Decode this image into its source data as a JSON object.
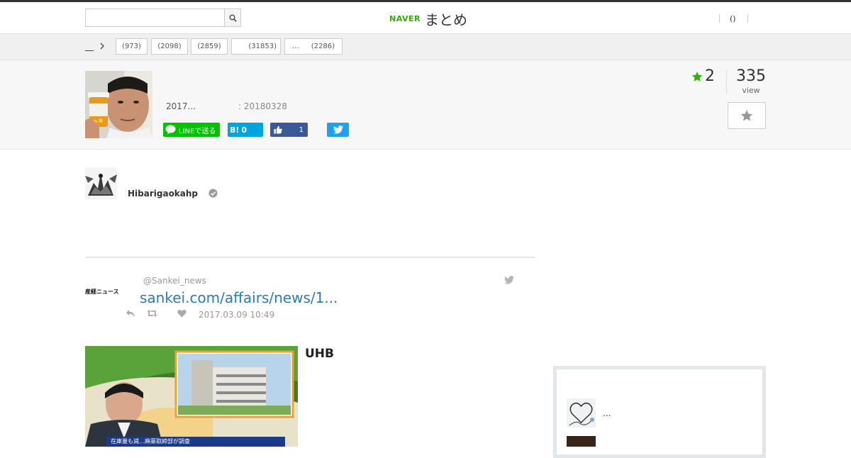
{
  "header": {
    "search": {
      "value": "",
      "placeholder": ""
    },
    "logo": {
      "naver": "NAVER",
      "matome": "まとめ"
    },
    "right_paren": "()"
  },
  "category_bar": {
    "home_label": "__",
    "tags": [
      {
        "label": "(973)"
      },
      {
        "label": "(2098)"
      },
      {
        "label": "(2859)"
      },
      {
        "label": "(31853)"
      },
      {
        "label": "...",
        "count": "(2286)"
      }
    ]
  },
  "article": {
    "date": "2017...",
    "updated": ": 20180328",
    "favorites": "2",
    "views": "335",
    "views_label": "view",
    "share": {
      "line_label": "LINEで送る",
      "hatena_label": "B!",
      "hatena_count": "0",
      "facebook_count": "1"
    }
  },
  "author": {
    "name": "Hibarigaokahp"
  },
  "tweet": {
    "account_logo_text": "産経ニュース",
    "handle": "@Sankei_news",
    "link": "sankei.com/affairs/news/1...",
    "time": "2017.03.09 10:49"
  },
  "news_item": {
    "source": "UHB",
    "caption": "在庫量も減…麻薬取締部が調査"
  },
  "sidebar": {
    "items": [
      {
        "text": "..."
      }
    ]
  },
  "colors": {
    "naver_green": "#2db400",
    "line_green": "#00c300",
    "hatena_blue": "#00a4de",
    "facebook_blue": "#3b5998",
    "twitter_blue": "#1da1f2",
    "link_blue": "#2b7bb9"
  }
}
